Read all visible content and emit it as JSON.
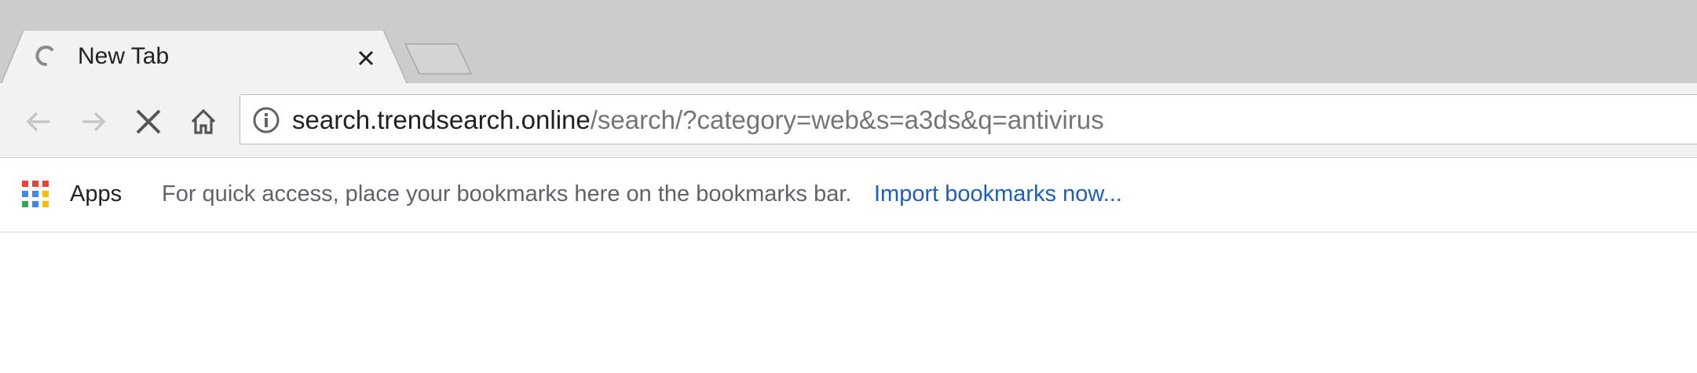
{
  "tab": {
    "title": "New Tab",
    "loading": true
  },
  "toolbar": {
    "url_host": "search.trendsearch.online",
    "url_rest": "/search/?category=web&s=a3ds&q=antivirus"
  },
  "bookmarks_bar": {
    "apps_label": "Apps",
    "hint": "For quick access, place your bookmarks here on the bookmarks bar.",
    "import_link": "Import bookmarks now..."
  },
  "icons": {
    "loading": "loading-spinner-icon",
    "close": "close-icon",
    "back": "back-arrow-icon",
    "forward": "forward-arrow-icon",
    "stop": "stop-icon",
    "home": "home-icon",
    "info": "info-icon",
    "apps": "apps-grid-icon"
  },
  "colors": {
    "tabstrip_bg": "#cccccc",
    "toolbar_bg": "#f2f2f2",
    "link": "#1a5fbf",
    "url_dim": "#757575"
  }
}
